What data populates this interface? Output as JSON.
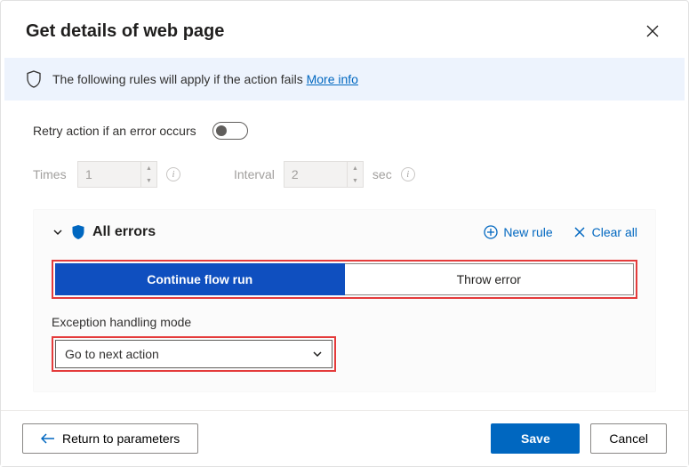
{
  "dialog": {
    "title": "Get details of web page"
  },
  "banner": {
    "text": "The following rules will apply if the action fails",
    "link": "More info"
  },
  "retry": {
    "label": "Retry action if an error occurs",
    "timesLabel": "Times",
    "timesValue": "1",
    "intervalLabel": "Interval",
    "intervalValue": "2",
    "unit": "sec"
  },
  "errors": {
    "title": "All errors",
    "newRule": "New rule",
    "clearAll": "Clear all",
    "continueLabel": "Continue flow run",
    "throwLabel": "Throw error",
    "modeLabel": "Exception handling mode",
    "modeValue": "Go to next action"
  },
  "footer": {
    "return": "Return to parameters",
    "save": "Save",
    "cancel": "Cancel"
  },
  "colors": {
    "accent": "#0067c0",
    "primaryBtn": "#0f4fbf",
    "highlight": "#e43b3b"
  }
}
